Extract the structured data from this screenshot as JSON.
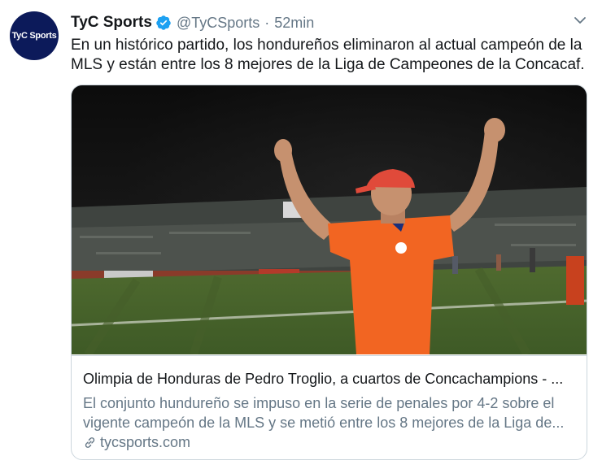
{
  "tweet": {
    "avatar_text": "TyC Sports",
    "display_name": "TyC Sports",
    "handle": "@TyCSports",
    "separator": "·",
    "time": "52min",
    "text": "En un histórico partido, los hondureños eliminaron al actual campeón de la MLS y están entre los 8 mejores de la Liga de Campeones de la Concacaf."
  },
  "card": {
    "title": "Olimpia de Honduras de Pedro Troglio, a cuartos de Concachampions - ...",
    "description_line1": "El conjunto hundureño se impuso en la serie de penales por 4-2 sobre el",
    "description_line2": "vigente campeón de la MLS y se metió entre los 8 mejores de la Liga de...",
    "domain": "tycsports.com"
  },
  "colors": {
    "verified_blue": "#1da1f2",
    "avatar_bg": "#0c1a5a",
    "jersey_orange": "#f26522",
    "secondary_text": "#657786"
  },
  "icons": [
    "verified-badge-icon",
    "caret-down-icon",
    "link-icon"
  ]
}
